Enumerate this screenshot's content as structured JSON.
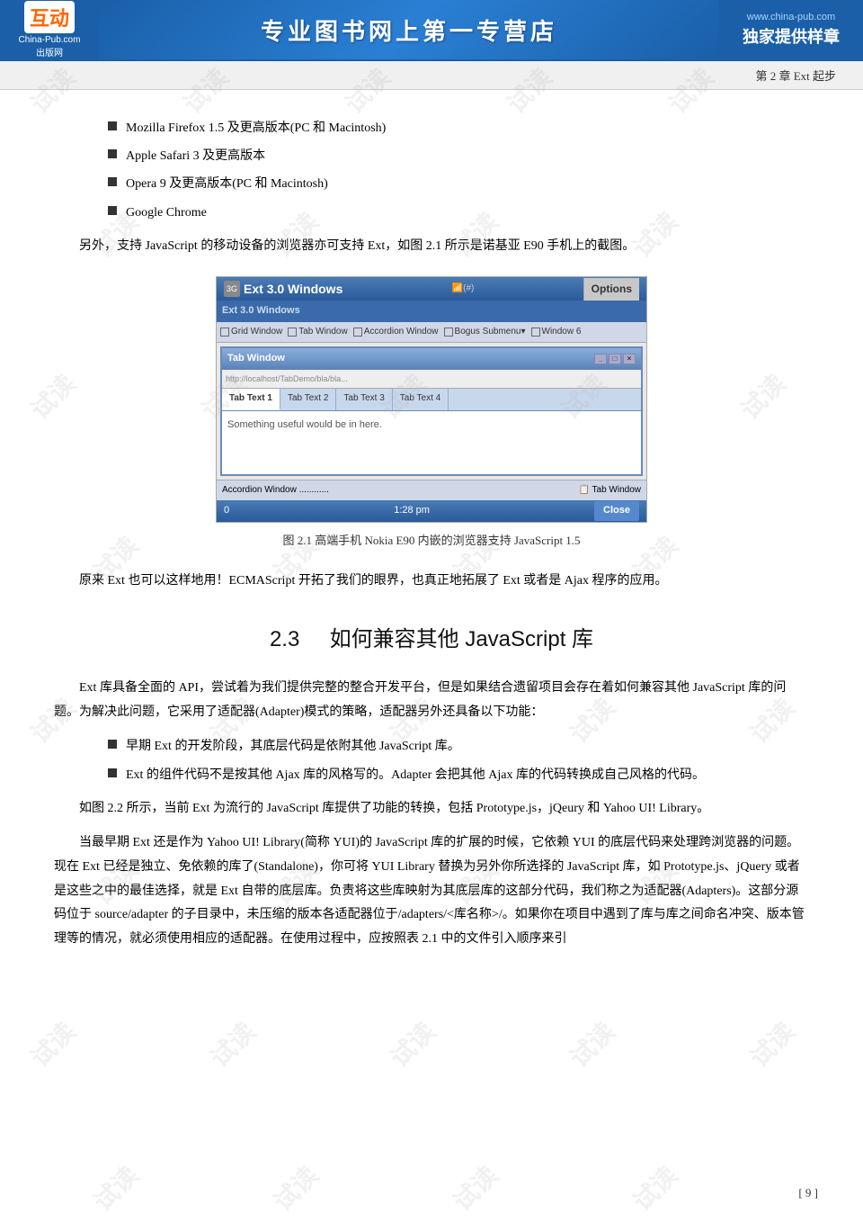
{
  "header": {
    "logo_icon": "互动",
    "logo_subtext": "China-Pub.com",
    "center_title": "专业图书网上第一专营店",
    "url": "www.china-pub.com",
    "exclusive": "独家提供样章"
  },
  "chapter_bar": {
    "text": "第 2 章   Ext 起步"
  },
  "bullets": [
    "Mozilla Firefox 1.5 及更高版本(PC 和 Macintosh)",
    "Apple Safari 3 及更高版本",
    "Opera 9 及更高版本(PC 和 Macintosh)",
    "Google Chrome"
  ],
  "paragraph1": "另外，支持 JavaScript 的移动设备的浏览器亦可支持 Ext，如图 2.1 所示是诺基亚 E90 手机上的截图。",
  "figure": {
    "caption": "图 2.1    高端手机 Nokia E90 内嵌的浏览器支持 JavaScript 1.5",
    "nokia_screen": {
      "header_left": "3G  Ext 3.0 Windows",
      "signal": "信号(#)",
      "options": "Options",
      "menubar": "Ext 3.0 Windows",
      "toolbar_items": [
        "Grid Window",
        "Tab Window",
        "Accordion Window",
        "Bogus Submenu▾",
        "Window 6"
      ],
      "window_title": "Tab Window",
      "win_tabs": [
        "Tab Text 1",
        "Tab Text 2",
        "Tab Text 3",
        "Tab Text 4"
      ],
      "win_content": "Something useful would be in here.",
      "bottom_left": "Accordion Window",
      "bottom_right": "Tab Window",
      "footer_left": "0",
      "footer_time": "1:28 pm",
      "footer_close": "Close"
    }
  },
  "paragraph2": "原来 Ext 也可以这样地用！ECMAScript 开拓了我们的眼界，也真正地拓展了 Ext 或者是 Ajax 程序的应用。",
  "section": {
    "number": "2.3",
    "title": "如何兼容其他 JavaScript 库"
  },
  "paragraph3": "Ext 库具备全面的 API，尝试着为我们提供完整的整合开发平台，但是如果结合遗留项目会存在着如何兼容其他 JavaScript 库的问题。为解决此问题，它采用了适配器(Adapter)模式的策略，适配器另外还具备以下功能：",
  "bullets2": [
    "早期 Ext 的开发阶段，其底层代码是依附其他 JavaScript 库。",
    "Ext 的组件代码不是按其他 Ajax 库的风格写的。Adapter 会把其他 Ajax 库的代码转换成自己风格的代码。"
  ],
  "paragraph4": "如图 2.2 所示，当前 Ext 为流行的 JavaScript 库提供了功能的转换，包括 Prototype.js，jQeury 和 Yahoo UI! Library。",
  "paragraph5": "当最早期 Ext 还是作为 Yahoo UI! Library(简称 YUI)的 JavaScript 库的扩展的时候，它依赖 YUI 的底层代码来处理跨浏览器的问题。现在 Ext 已经是独立、免依赖的库了(Standalone)，你可将 YUI  Library 替换为另外你所选择的 JavaScript 库，如 Prototype.js、jQuery 或者是这些之中的最佳选择，就是  Ext 自带的底层库。负责将这些库映射为其底层库的这部分代码，我们称之为适配器(Adapters)。这部分源码位于 source/adapter 的子目录中，未压缩的版本各适配器位于/adapters/<库名称>/。如果你在项目中遇到了库与库之间命名冲突、版本管理等的情况，就必须使用相应的适配器。在使用过程中，应按照表 2.1 中的文件引入顺序来引",
  "page_number": "[ 9 ]",
  "watermarks": [
    "试",
    "读",
    "试",
    "读",
    "试",
    "读",
    "试",
    "读"
  ]
}
